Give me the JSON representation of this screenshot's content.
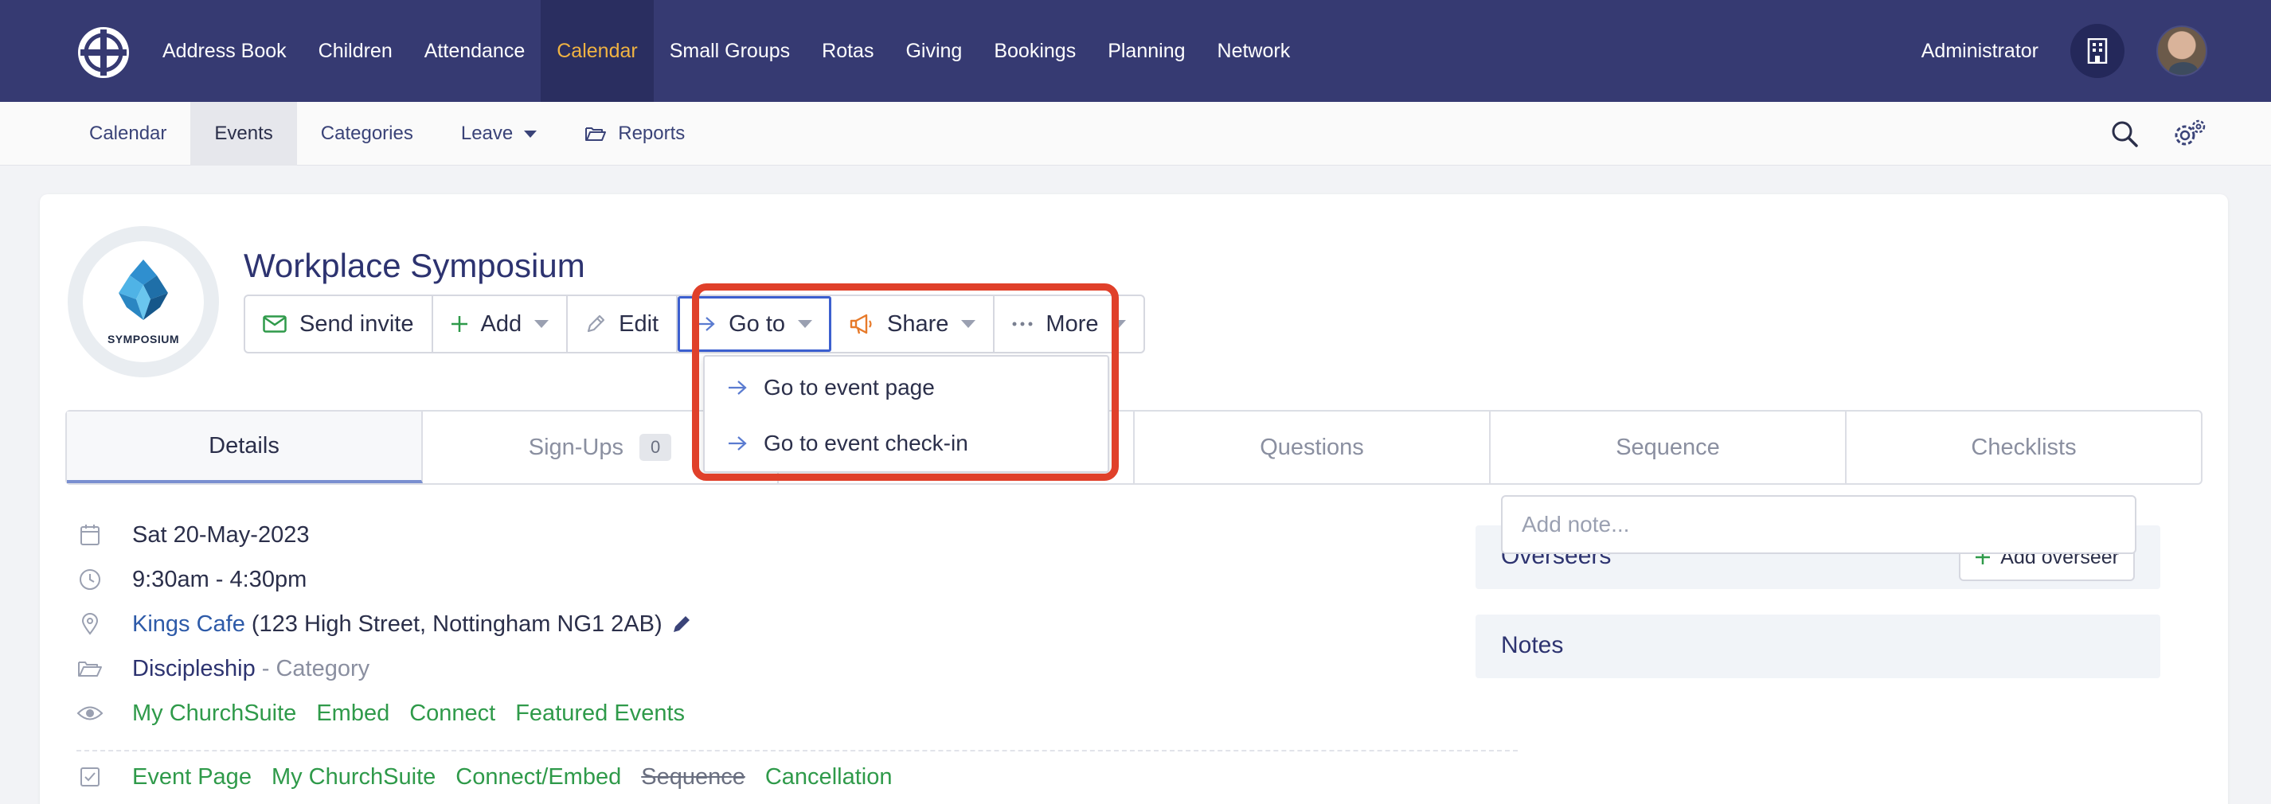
{
  "topnav": {
    "items": [
      {
        "label": "Address Book",
        "active": false
      },
      {
        "label": "Children",
        "active": false
      },
      {
        "label": "Attendance",
        "active": false
      },
      {
        "label": "Calendar",
        "active": true
      },
      {
        "label": "Small Groups",
        "active": false
      },
      {
        "label": "Rotas",
        "active": false
      },
      {
        "label": "Giving",
        "active": false
      },
      {
        "label": "Bookings",
        "active": false
      },
      {
        "label": "Planning",
        "active": false
      },
      {
        "label": "Network",
        "active": false
      }
    ],
    "admin_label": "Administrator",
    "org_icon": "building-icon",
    "avatar_icon": "user-avatar"
  },
  "subnav": {
    "items": [
      {
        "label": "Calendar",
        "active": false
      },
      {
        "label": "Events",
        "active": true
      },
      {
        "label": "Categories",
        "active": false
      },
      {
        "label": "Leave",
        "active": false,
        "dropdown": true
      },
      {
        "label": "Reports",
        "active": false,
        "icon": "folder-icon"
      }
    ],
    "right_icons": [
      "search-icon",
      "settings-gear-icon"
    ]
  },
  "event": {
    "title": "Workplace Symposium",
    "image_text": "SYMPOSIUM"
  },
  "actions": {
    "send_invite": "Send invite",
    "add": "Add",
    "edit": "Edit",
    "goto": "Go to",
    "share": "Share",
    "more": "More"
  },
  "goto_menu": {
    "items": [
      "Go to event page",
      "Go to event check-in"
    ]
  },
  "tabs": {
    "details": "Details",
    "signups": "Sign-Ups",
    "signups_count": "0",
    "questions": "Questions",
    "sequence": "Sequence",
    "checklists": "Checklists"
  },
  "details": {
    "date": "Sat 20-May-2023",
    "time": "9:30am - 4:30pm",
    "venue_name": "Kings Cafe",
    "venue_address": "(123 High Street, Nottingham NG1 2AB)",
    "category": "Discipleship",
    "category_suffix": "- Category",
    "visibility": [
      "My ChurchSuite",
      "Embed",
      "Connect",
      "Featured Events"
    ],
    "checks": [
      {
        "label": "Event Page",
        "enabled": true
      },
      {
        "label": "My ChurchSuite",
        "enabled": true
      },
      {
        "label": "Connect/Embed",
        "enabled": true
      },
      {
        "label": "Sequence",
        "enabled": false
      },
      {
        "label": "Cancellation",
        "enabled": true
      }
    ]
  },
  "overseers": {
    "title": "Overseers",
    "add_button": "Add overseer"
  },
  "notes": {
    "title": "Notes",
    "placeholder": "Add note..."
  },
  "colors": {
    "nav_bg": "#363a72",
    "nav_active": "#f0b342",
    "link_green": "#2f9a4a",
    "highlight_red": "#e0402a",
    "focus_blue": "#3c5fcf"
  }
}
